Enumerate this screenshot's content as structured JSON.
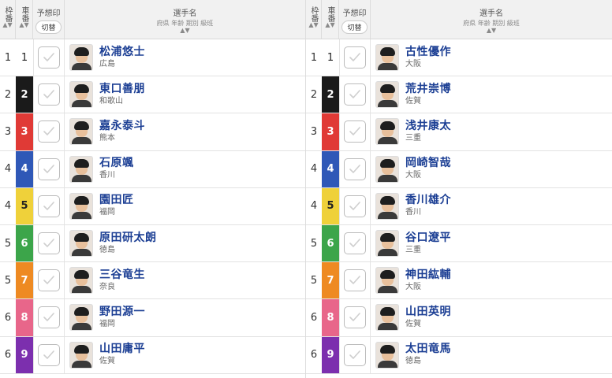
{
  "header": {
    "waku_label": "枠番",
    "car_label": "車番",
    "yoso_label": "予想印",
    "toggle_label": "切替",
    "name_label": "選手名",
    "name_sub": "府県 年齢 期別 級班",
    "sort_glyph": "▲▼"
  },
  "colors": {
    "car_bg": [
      "#ffffff",
      "#1a1a1a",
      "#e03a36",
      "#2f58b7",
      "#efd13a",
      "#3ca54a",
      "#ee8a22",
      "#e8668a",
      "#7c2fae"
    ],
    "car_fg": [
      "#222222",
      "#ffffff",
      "#ffffff",
      "#ffffff",
      "#222222",
      "#ffffff",
      "#ffffff",
      "#ffffff",
      "#ffffff"
    ],
    "name": "#1c3f94"
  },
  "left": {
    "rows": [
      {
        "waku": "1",
        "car": "1",
        "name": "松浦悠士",
        "pref": "広島"
      },
      {
        "waku": "2",
        "car": "2",
        "name": "東口善朋",
        "pref": "和歌山"
      },
      {
        "waku": "3",
        "car": "3",
        "name": "嘉永泰斗",
        "pref": "熊本"
      },
      {
        "waku": "4",
        "car": "4",
        "name": "石原颯",
        "pref": "香川"
      },
      {
        "waku": "4",
        "car": "5",
        "name": "園田匠",
        "pref": "福岡"
      },
      {
        "waku": "5",
        "car": "6",
        "name": "原田研太朗",
        "pref": "徳島"
      },
      {
        "waku": "5",
        "car": "7",
        "name": "三谷竜生",
        "pref": "奈良"
      },
      {
        "waku": "6",
        "car": "8",
        "name": "野田源一",
        "pref": "福岡"
      },
      {
        "waku": "6",
        "car": "9",
        "name": "山田庸平",
        "pref": "佐賀"
      }
    ]
  },
  "right": {
    "rows": [
      {
        "waku": "1",
        "car": "1",
        "name": "古性優作",
        "pref": "大阪"
      },
      {
        "waku": "2",
        "car": "2",
        "name": "荒井崇博",
        "pref": "佐賀"
      },
      {
        "waku": "3",
        "car": "3",
        "name": "浅井康太",
        "pref": "三重"
      },
      {
        "waku": "4",
        "car": "4",
        "name": "岡崎智哉",
        "pref": "大阪"
      },
      {
        "waku": "4",
        "car": "5",
        "name": "香川雄介",
        "pref": "香川"
      },
      {
        "waku": "5",
        "car": "6",
        "name": "谷口遼平",
        "pref": "三重"
      },
      {
        "waku": "5",
        "car": "7",
        "name": "神田紘輔",
        "pref": "大阪"
      },
      {
        "waku": "6",
        "car": "8",
        "name": "山田英明",
        "pref": "佐賀"
      },
      {
        "waku": "6",
        "car": "9",
        "name": "太田竜馬",
        "pref": "徳島"
      }
    ]
  }
}
